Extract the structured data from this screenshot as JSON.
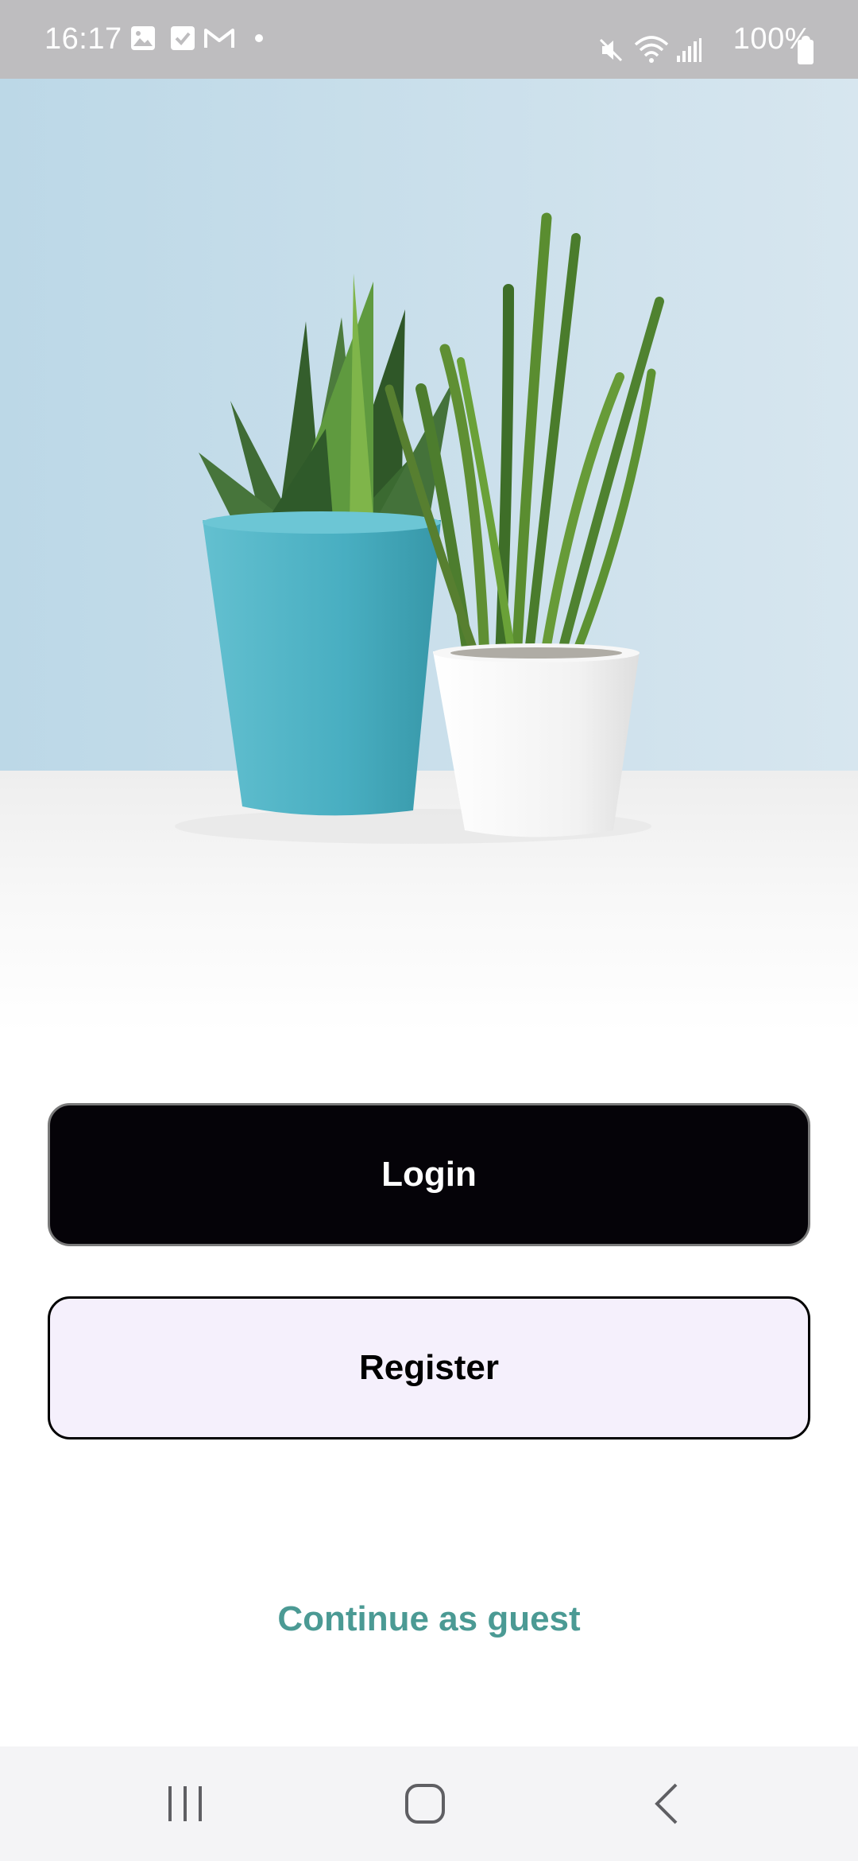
{
  "status_bar": {
    "time": "16:17",
    "battery": "100%",
    "left_icons": [
      "gallery-icon",
      "checkbox-icon",
      "gmail-icon",
      "dot-icon"
    ],
    "right_icons": [
      "mute-icon",
      "wifi-icon",
      "signal-icon",
      "battery-icon"
    ]
  },
  "hero": {
    "image": "succulent-plants-in-pots",
    "colors": {
      "wall": "#c9dfea",
      "table": "#f7f7f7",
      "teal_pot": "#4fb2c4",
      "white_pot": "#f4f4f4"
    }
  },
  "actions": {
    "login_label": "Login",
    "register_label": "Register",
    "guest_label": "Continue as guest"
  },
  "nav_bar": {
    "items": [
      "recent-apps-icon",
      "home-icon",
      "back-icon"
    ]
  },
  "colors": {
    "login_bg": "#050308",
    "register_bg": "#f5f0fc",
    "guest_text": "#4b9a94",
    "status_bar_bg": "#bebdbf"
  }
}
